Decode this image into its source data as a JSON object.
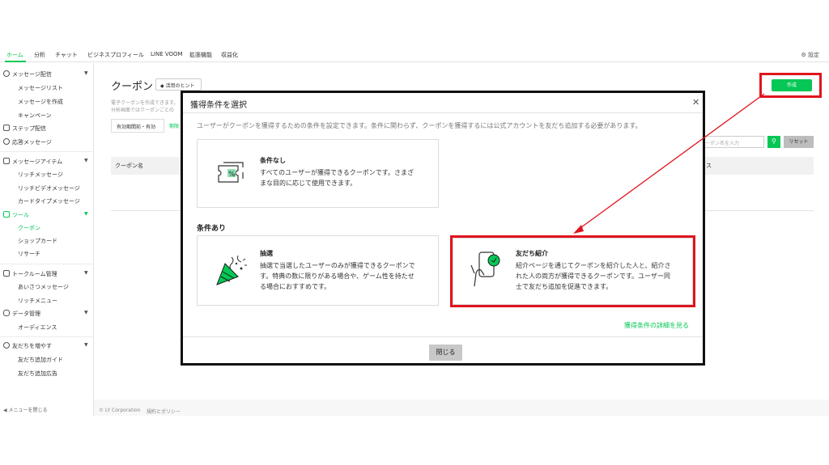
{
  "colors": {
    "accent": "#06c755",
    "highlight": "#e0141e",
    "text": "#333333"
  },
  "topnav": {
    "items": [
      "ホーム",
      "分析",
      "チャット",
      "ビジネスプロフィール",
      "LINE VOOM",
      "拡張機能",
      "収益化"
    ],
    "active": "ホーム",
    "settings": "⚙ 設定"
  },
  "sidebar": {
    "messages": {
      "label": "メッセージ配信",
      "items": [
        "メッセージリスト",
        "メッセージを作成",
        "キャンペーン"
      ]
    },
    "step": "ステップ配信",
    "response": "応答メッセージ",
    "msg_items": {
      "label": "メッセージアイテム",
      "items": [
        "リッチメッセージ",
        "リッチビデオメッセージ",
        "カードタイプメッセージ"
      ]
    },
    "tools": {
      "label": "ツール",
      "items": [
        "クーポン",
        "ショップカード",
        "リサーチ"
      ]
    },
    "talk": {
      "label": "トークルーム管理",
      "items": [
        "あいさつメッセージ",
        "リッチメニュー"
      ]
    },
    "data": {
      "label": "データ管理",
      "items": [
        "オーディエンス"
      ]
    },
    "friends": {
      "label": "友だちを増やす",
      "items": [
        "友だち追加ガイド",
        "友だち追加広告"
      ]
    },
    "footer": "◀ メニューを閉じる"
  },
  "main": {
    "title": "クーポン",
    "hint": "◆ 活用のヒント",
    "desc1": "電子クーポンを作成できます。",
    "desc2": "分析画面ではクーポンごとの",
    "filter_tab": "有効期間前・有効",
    "filter_tab2": "期限",
    "col_name": "クーポン名",
    "col_status": "ス",
    "create": "作成",
    "search_placeholder": "ーポン名を入力",
    "search_icon": "⚲",
    "reset": "リセット",
    "copyright": "© LY Corporation",
    "policy": "規約とポリシー"
  },
  "modal": {
    "title": "獲得条件を選択",
    "close_icon": "✕",
    "desc": "ユーザーがクーポンを獲得するための条件を設定できます。条件に関わらず、クーポンを獲得するには公式アカウントを友だち追加する必要があります。",
    "none": {
      "title": "条件なし",
      "lines": [
        "すべてのユーザーが獲得できるクーポンです。さまざ",
        "まな目的に応じて使用できます。"
      ],
      "icon": "coupon-percent-icon"
    },
    "section": "条件あり",
    "lottery": {
      "title": "抽選",
      "lines": [
        "抽選で当選したユーザーのみが獲得できるクーポンで",
        "す。特典の数に限りがある場合や、ゲーム性を持たせ",
        "る場合におすすめです。"
      ],
      "icon": "party-popper-icon"
    },
    "referral": {
      "title": "友だち紹介",
      "lines": [
        "紹介ページを通じてクーポンを紹介した人と、紹介さ",
        "れた人の両方が獲得できるクーポンです。ユーザー同",
        "士で友だち追加を促進できます。"
      ],
      "icon": "phone-share-icon"
    },
    "detail_link": "獲得条件の詳細を見る",
    "close_button": "閉じる"
  }
}
